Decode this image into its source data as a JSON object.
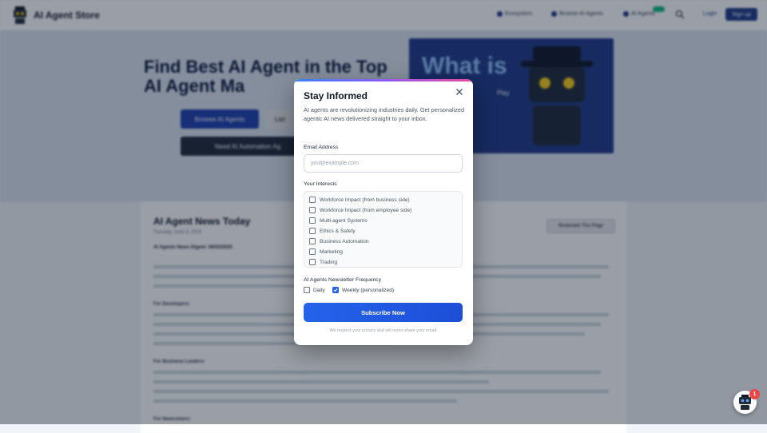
{
  "header": {
    "app_name": "AI Agent Store",
    "nav": [
      "Ecosystem",
      "Browse AI Agents",
      "AI Agents"
    ],
    "login_label": "Login",
    "signup_label": "Sign up"
  },
  "hero": {
    "title": "Find Best AI Agent in the Top AI Agent Ma",
    "browse_button": "Browse AI Agents",
    "list_button": "List",
    "automation_button": "Need AI Automation Ag",
    "video_title": "What is",
    "video_play": "Play"
  },
  "news": {
    "title": "AI Agent News Today",
    "date": "Tuesday, June 3, 2025",
    "subtitle": "AI Agents News Digest: 06/03/2025",
    "bookmark_label": "Bookmark This Page",
    "section_developers": "For Developers:",
    "section_business": "For Business Leaders:",
    "section_newcomers": "For Newcomers:"
  },
  "modal": {
    "title": "Stay Informed",
    "description": "AI agents are revolutionizing industries daily. Get personalized agentic AI news delivered straight to your inbox.",
    "email_label": "Email Address",
    "email_placeholder": "you@example.com",
    "interests_label": "Your Interests",
    "interests": [
      {
        "label": "Workforce Impact (from business side)",
        "checked": false
      },
      {
        "label": "Workforce Impact (from employee side)",
        "checked": false
      },
      {
        "label": "Multi-agent Systems",
        "checked": false
      },
      {
        "label": "Ethics & Safety",
        "checked": false
      },
      {
        "label": "Business Automation",
        "checked": false
      },
      {
        "label": "Marketing",
        "checked": false
      },
      {
        "label": "Trading",
        "checked": false
      }
    ],
    "frequency_label": "AI Agents Newsletter Frequency",
    "frequency_daily": "Daily",
    "frequency_weekly": "Weekly (personalized)",
    "daily_checked": false,
    "weekly_checked": true,
    "subscribe_label": "Subscribe Now",
    "privacy_note": "We respect your privacy and will never share your email."
  },
  "chat": {
    "badge_count": "1"
  },
  "colors": {
    "primary": "#2563eb",
    "brand_navy": "#1e3a8a",
    "overlay": "rgba(15,23,42,0.42)"
  }
}
